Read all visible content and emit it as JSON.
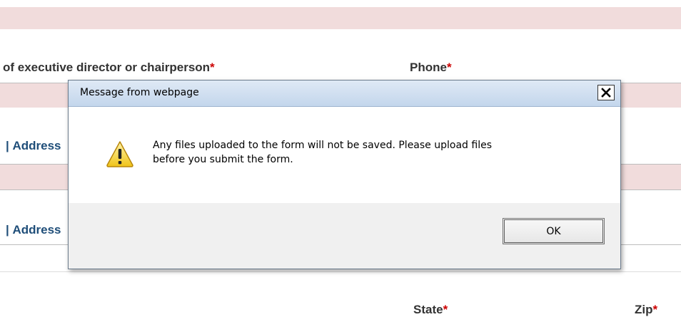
{
  "form": {
    "exec_label": "of executive director or chairperson",
    "phone_label": "Phone",
    "address_label_1": "Address",
    "address_label_2": "Address",
    "state_label": "State",
    "zip_label": "Zip",
    "required_marker": "*"
  },
  "dialog": {
    "title": "Message from webpage",
    "close_glyph": "✕",
    "message_line1": "Any files uploaded to the form will not be saved.  Please upload files",
    "message_line2": "before you submit the form.",
    "ok_label": "OK",
    "icon": "warning-icon"
  },
  "colors": {
    "band": "#f1dcdc",
    "label_blue": "#1f4e79",
    "required": "#cc0000"
  }
}
